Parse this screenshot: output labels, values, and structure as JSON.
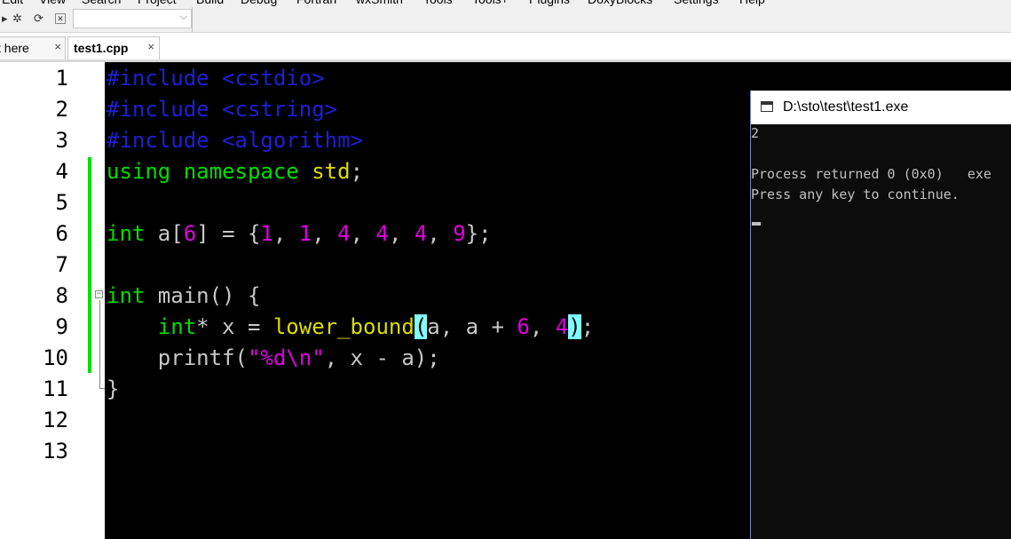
{
  "menu": [
    "Edit",
    "View",
    "Search",
    "Project",
    "Build",
    "Debug",
    "Fortran",
    "wxSmith",
    "Tools",
    "Tools+",
    "Plugins",
    "DoxyBlocks",
    "Settings",
    "Help"
  ],
  "toolbar": {
    "icons": [
      "arrow-right-icon",
      "bug-icon",
      "refresh-icon",
      "close-icon"
    ]
  },
  "tabs": [
    {
      "label": "t here",
      "close": "×"
    },
    {
      "label": "test1.cpp",
      "close": "×",
      "active": true
    }
  ],
  "editor": {
    "line_numbers": [
      "1",
      "2",
      "3",
      "4",
      "5",
      "6",
      "7",
      "8",
      "9",
      "10",
      "11",
      "12",
      "13"
    ],
    "lines": [
      [
        {
          "t": "#include <cstdio>",
          "c": "pp"
        }
      ],
      [
        {
          "t": "#include <cstring>",
          "c": "pp"
        }
      ],
      [
        {
          "t": "#include <algorithm>",
          "c": "pp"
        }
      ],
      [
        {
          "t": "using",
          "c": "kw"
        },
        {
          "t": " ",
          "c": "id"
        },
        {
          "t": "namespace",
          "c": "kw"
        },
        {
          "t": " ",
          "c": "id"
        },
        {
          "t": "std",
          "c": "fn"
        },
        {
          "t": ";",
          "c": "id"
        }
      ],
      [],
      [
        {
          "t": "int",
          "c": "kw"
        },
        {
          "t": " a[",
          "c": "id"
        },
        {
          "t": "6",
          "c": "nm"
        },
        {
          "t": "] = {",
          "c": "id"
        },
        {
          "t": "1",
          "c": "nm"
        },
        {
          "t": ", ",
          "c": "id"
        },
        {
          "t": "1",
          "c": "nm"
        },
        {
          "t": ", ",
          "c": "id"
        },
        {
          "t": "4",
          "c": "nm"
        },
        {
          "t": ", ",
          "c": "id"
        },
        {
          "t": "4",
          "c": "nm"
        },
        {
          "t": ", ",
          "c": "id"
        },
        {
          "t": "4",
          "c": "nm"
        },
        {
          "t": ", ",
          "c": "id"
        },
        {
          "t": "9",
          "c": "nm"
        },
        {
          "t": "};",
          "c": "id"
        }
      ],
      [],
      [
        {
          "t": "int",
          "c": "kw"
        },
        {
          "t": " main() {",
          "c": "id"
        }
      ],
      [
        {
          "t": "    ",
          "c": "id"
        },
        {
          "t": "int",
          "c": "kw"
        },
        {
          "t": "* x = ",
          "c": "id"
        },
        {
          "t": "lower_bound",
          "c": "fn"
        },
        {
          "t": "(",
          "c": "br"
        },
        {
          "t": "a, a + ",
          "c": "id"
        },
        {
          "t": "6",
          "c": "nm"
        },
        {
          "t": ", ",
          "c": "id"
        },
        {
          "t": "4",
          "c": "nm"
        },
        {
          "t": ")",
          "c": "br"
        },
        {
          "t": ";",
          "c": "id"
        }
      ],
      [
        {
          "t": "    printf(",
          "c": "id"
        },
        {
          "t": "\"%d\\n\"",
          "c": "st"
        },
        {
          "t": ", x - a);",
          "c": "id"
        }
      ],
      [
        {
          "t": "}",
          "c": "id"
        }
      ],
      [],
      []
    ]
  },
  "console": {
    "title": "D:\\sto\\test\\test1.exe",
    "output": [
      "2",
      "",
      "Process returned 0 (0x0)   exe",
      "Press any key to continue."
    ]
  }
}
